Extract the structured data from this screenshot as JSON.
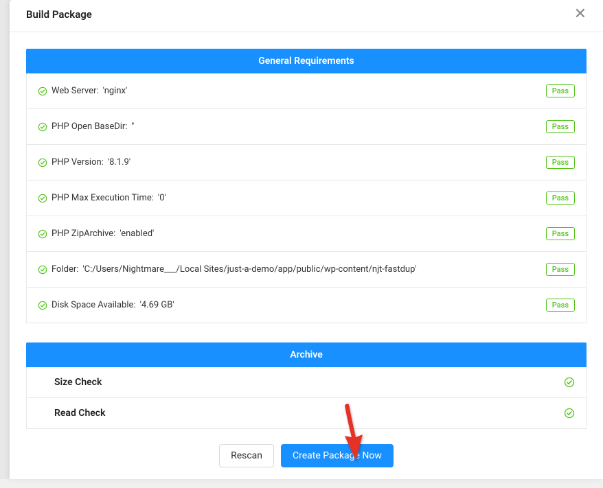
{
  "modal": {
    "title": "Build Package",
    "close_label": "✕"
  },
  "general": {
    "header": "General Requirements",
    "rows": [
      {
        "label": "Web Server:",
        "value": "'nginx'",
        "status": "Pass"
      },
      {
        "label": "PHP Open BaseDir:",
        "value": "''",
        "status": "Pass"
      },
      {
        "label": "PHP Version:",
        "value": "'8.1.9'",
        "status": "Pass"
      },
      {
        "label": "PHP Max Execution Time:",
        "value": "'0'",
        "status": "Pass"
      },
      {
        "label": "PHP ZipArchive:",
        "value": "'enabled'",
        "status": "Pass"
      },
      {
        "label": "Folder:",
        "value": "'C:/Users/Nightmare___/Local Sites/just-a-demo/app/public/wp-content/njt-fastdup'",
        "status": "Pass"
      },
      {
        "label": "Disk Space Available:",
        "value": "'4.69 GB'",
        "status": "Pass"
      }
    ]
  },
  "archive": {
    "header": "Archive",
    "rows": [
      {
        "label": "Size Check"
      },
      {
        "label": "Read Check"
      }
    ]
  },
  "footer": {
    "rescan_label": "Rescan",
    "create_label": "Create Package Now"
  }
}
